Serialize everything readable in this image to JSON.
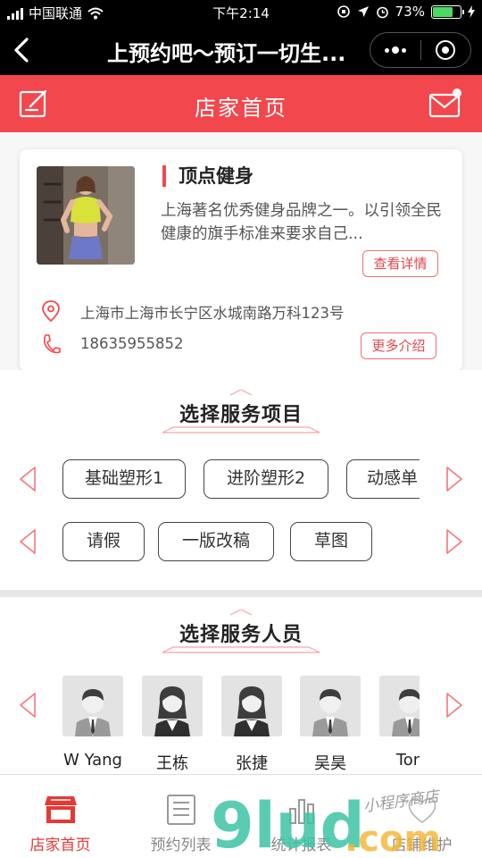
{
  "status_bar": {
    "carrier": "中国联通",
    "time": "下午2:14",
    "battery_percent": "73%",
    "battery_level": 0.73
  },
  "nav": {
    "title": "上预约吧～预订一切生..."
  },
  "header": {
    "title": "店家首页"
  },
  "shop": {
    "name": "顶点健身",
    "description": "上海著名优秀健身品牌之一。以引领全民健康的旗手标准来要求自己...",
    "detail_button": "查看详情",
    "address": "上海市上海市长宁区水城南路万科123号",
    "phone": "18635955852",
    "more_button": "更多介绍"
  },
  "services": {
    "title": "选择服务项目",
    "row1": [
      "基础塑形1",
      "进阶塑形2",
      "动感单"
    ],
    "row2": [
      "请假",
      "一版改稿",
      "草图"
    ]
  },
  "staff": {
    "title": "选择服务人员",
    "members": [
      {
        "name": "W Yang",
        "gender": "male"
      },
      {
        "name": "王栋",
        "gender": "female"
      },
      {
        "name": "张捷",
        "gender": "female"
      },
      {
        "name": "吴昊",
        "gender": "male"
      },
      {
        "name": "Ton",
        "gender": "male"
      }
    ]
  },
  "tabbar": {
    "tabs": [
      {
        "label": "店家首页",
        "icon": "shop-icon",
        "active": true
      },
      {
        "label": "预约列表",
        "icon": "list-icon",
        "active": false
      },
      {
        "label": "统计报表",
        "icon": "chart-icon",
        "active": false
      },
      {
        "label": "店铺维护",
        "icon": "settings-icon",
        "active": false
      }
    ]
  },
  "watermark": {
    "logo_text": "9lud.com",
    "script_text": "小程序商店"
  },
  "colors": {
    "accent": "#f2474d",
    "tab_active": "#e53935"
  }
}
